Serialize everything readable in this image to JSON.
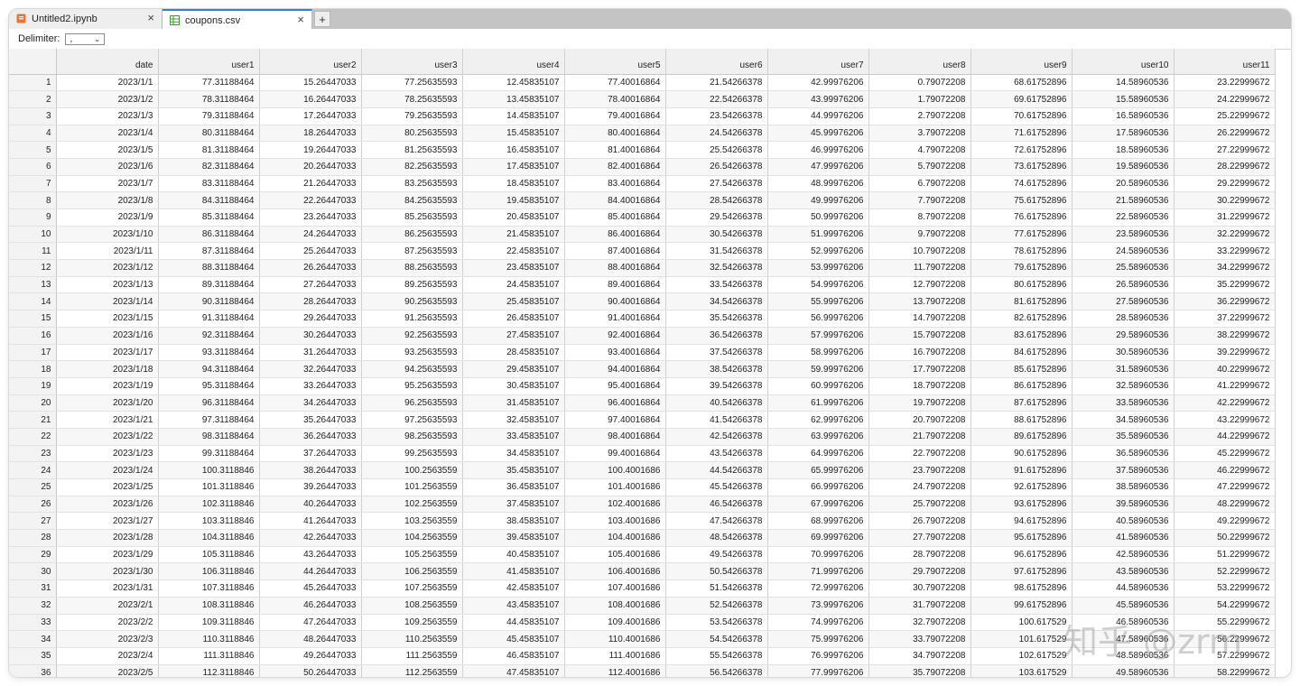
{
  "tabs": [
    {
      "label": "Untitled2.ipynb",
      "icon": "notebook-icon",
      "active": false,
      "icon_color": "#e8743b"
    },
    {
      "label": "coupons.csv",
      "icon": "table-grid-icon",
      "active": true,
      "icon_color": "#3f9c35"
    }
  ],
  "tab_add_label": "+",
  "tab_close_label": "×",
  "toolbar": {
    "delimiter_label": "Delimiter:",
    "delimiter_value": ","
  },
  "columns": [
    "",
    "date",
    "user1",
    "user2",
    "user3",
    "user4",
    "user5",
    "user6",
    "user7",
    "user8",
    "user9",
    "user10",
    "user11"
  ],
  "rows": [
    [
      "1",
      "2023/1/1",
      "77.31188464",
      "15.26447033",
      "77.25635593",
      "12.45835107",
      "77.40016864",
      "21.54266378",
      "42.99976206",
      "0.79072208",
      "68.61752896",
      "14.58960536",
      "23.22999672"
    ],
    [
      "2",
      "2023/1/2",
      "78.31188464",
      "16.26447033",
      "78.25635593",
      "13.45835107",
      "78.40016864",
      "22.54266378",
      "43.99976206",
      "1.79072208",
      "69.61752896",
      "15.58960536",
      "24.22999672"
    ],
    [
      "3",
      "2023/1/3",
      "79.31188464",
      "17.26447033",
      "79.25635593",
      "14.45835107",
      "79.40016864",
      "23.54266378",
      "44.99976206",
      "2.79072208",
      "70.61752896",
      "16.58960536",
      "25.22999672"
    ],
    [
      "4",
      "2023/1/4",
      "80.31188464",
      "18.26447033",
      "80.25635593",
      "15.45835107",
      "80.40016864",
      "24.54266378",
      "45.99976206",
      "3.79072208",
      "71.61752896",
      "17.58960536",
      "26.22999672"
    ],
    [
      "5",
      "2023/1/5",
      "81.31188464",
      "19.26447033",
      "81.25635593",
      "16.45835107",
      "81.40016864",
      "25.54266378",
      "46.99976206",
      "4.79072208",
      "72.61752896",
      "18.58960536",
      "27.22999672"
    ],
    [
      "6",
      "2023/1/6",
      "82.31188464",
      "20.26447033",
      "82.25635593",
      "17.45835107",
      "82.40016864",
      "26.54266378",
      "47.99976206",
      "5.79072208",
      "73.61752896",
      "19.58960536",
      "28.22999672"
    ],
    [
      "7",
      "2023/1/7",
      "83.31188464",
      "21.26447033",
      "83.25635593",
      "18.45835107",
      "83.40016864",
      "27.54266378",
      "48.99976206",
      "6.79072208",
      "74.61752896",
      "20.58960536",
      "29.22999672"
    ],
    [
      "8",
      "2023/1/8",
      "84.31188464",
      "22.26447033",
      "84.25635593",
      "19.45835107",
      "84.40016864",
      "28.54266378",
      "49.99976206",
      "7.79072208",
      "75.61752896",
      "21.58960536",
      "30.22999672"
    ],
    [
      "9",
      "2023/1/9",
      "85.31188464",
      "23.26447033",
      "85.25635593",
      "20.45835107",
      "85.40016864",
      "29.54266378",
      "50.99976206",
      "8.79072208",
      "76.61752896",
      "22.58960536",
      "31.22999672"
    ],
    [
      "10",
      "2023/1/10",
      "86.31188464",
      "24.26447033",
      "86.25635593",
      "21.45835107",
      "86.40016864",
      "30.54266378",
      "51.99976206",
      "9.79072208",
      "77.61752896",
      "23.58960536",
      "32.22999672"
    ],
    [
      "11",
      "2023/1/11",
      "87.31188464",
      "25.26447033",
      "87.25635593",
      "22.45835107",
      "87.40016864",
      "31.54266378",
      "52.99976206",
      "10.79072208",
      "78.61752896",
      "24.58960536",
      "33.22999672"
    ],
    [
      "12",
      "2023/1/12",
      "88.31188464",
      "26.26447033",
      "88.25635593",
      "23.45835107",
      "88.40016864",
      "32.54266378",
      "53.99976206",
      "11.79072208",
      "79.61752896",
      "25.58960536",
      "34.22999672"
    ],
    [
      "13",
      "2023/1/13",
      "89.31188464",
      "27.26447033",
      "89.25635593",
      "24.45835107",
      "89.40016864",
      "33.54266378",
      "54.99976206",
      "12.79072208",
      "80.61752896",
      "26.58960536",
      "35.22999672"
    ],
    [
      "14",
      "2023/1/14",
      "90.31188464",
      "28.26447033",
      "90.25635593",
      "25.45835107",
      "90.40016864",
      "34.54266378",
      "55.99976206",
      "13.79072208",
      "81.61752896",
      "27.58960536",
      "36.22999672"
    ],
    [
      "15",
      "2023/1/15",
      "91.31188464",
      "29.26447033",
      "91.25635593",
      "26.45835107",
      "91.40016864",
      "35.54266378",
      "56.99976206",
      "14.79072208",
      "82.61752896",
      "28.58960536",
      "37.22999672"
    ],
    [
      "16",
      "2023/1/16",
      "92.31188464",
      "30.26447033",
      "92.25635593",
      "27.45835107",
      "92.40016864",
      "36.54266378",
      "57.99976206",
      "15.79072208",
      "83.61752896",
      "29.58960536",
      "38.22999672"
    ],
    [
      "17",
      "2023/1/17",
      "93.31188464",
      "31.26447033",
      "93.25635593",
      "28.45835107",
      "93.40016864",
      "37.54266378",
      "58.99976206",
      "16.79072208",
      "84.61752896",
      "30.58960536",
      "39.22999672"
    ],
    [
      "18",
      "2023/1/18",
      "94.31188464",
      "32.26447033",
      "94.25635593",
      "29.45835107",
      "94.40016864",
      "38.54266378",
      "59.99976206",
      "17.79072208",
      "85.61752896",
      "31.58960536",
      "40.22999672"
    ],
    [
      "19",
      "2023/1/19",
      "95.31188464",
      "33.26447033",
      "95.25635593",
      "30.45835107",
      "95.40016864",
      "39.54266378",
      "60.99976206",
      "18.79072208",
      "86.61752896",
      "32.58960536",
      "41.22999672"
    ],
    [
      "20",
      "2023/1/20",
      "96.31188464",
      "34.26447033",
      "96.25635593",
      "31.45835107",
      "96.40016864",
      "40.54266378",
      "61.99976206",
      "19.79072208",
      "87.61752896",
      "33.58960536",
      "42.22999672"
    ],
    [
      "21",
      "2023/1/21",
      "97.31188464",
      "35.26447033",
      "97.25635593",
      "32.45835107",
      "97.40016864",
      "41.54266378",
      "62.99976206",
      "20.79072208",
      "88.61752896",
      "34.58960536",
      "43.22999672"
    ],
    [
      "22",
      "2023/1/22",
      "98.31188464",
      "36.26447033",
      "98.25635593",
      "33.45835107",
      "98.40016864",
      "42.54266378",
      "63.99976206",
      "21.79072208",
      "89.61752896",
      "35.58960536",
      "44.22999672"
    ],
    [
      "23",
      "2023/1/23",
      "99.31188464",
      "37.26447033",
      "99.25635593",
      "34.45835107",
      "99.40016864",
      "43.54266378",
      "64.99976206",
      "22.79072208",
      "90.61752896",
      "36.58960536",
      "45.22999672"
    ],
    [
      "24",
      "2023/1/24",
      "100.3118846",
      "38.26447033",
      "100.2563559",
      "35.45835107",
      "100.4001686",
      "44.54266378",
      "65.99976206",
      "23.79072208",
      "91.61752896",
      "37.58960536",
      "46.22999672"
    ],
    [
      "25",
      "2023/1/25",
      "101.3118846",
      "39.26447033",
      "101.2563559",
      "36.45835107",
      "101.4001686",
      "45.54266378",
      "66.99976206",
      "24.79072208",
      "92.61752896",
      "38.58960536",
      "47.22999672"
    ],
    [
      "26",
      "2023/1/26",
      "102.3118846",
      "40.26447033",
      "102.2563559",
      "37.45835107",
      "102.4001686",
      "46.54266378",
      "67.99976206",
      "25.79072208",
      "93.61752896",
      "39.58960536",
      "48.22999672"
    ],
    [
      "27",
      "2023/1/27",
      "103.3118846",
      "41.26447033",
      "103.2563559",
      "38.45835107",
      "103.4001686",
      "47.54266378",
      "68.99976206",
      "26.79072208",
      "94.61752896",
      "40.58960536",
      "49.22999672"
    ],
    [
      "28",
      "2023/1/28",
      "104.3118846",
      "42.26447033",
      "104.2563559",
      "39.45835107",
      "104.4001686",
      "48.54266378",
      "69.99976206",
      "27.79072208",
      "95.61752896",
      "41.58960536",
      "50.22999672"
    ],
    [
      "29",
      "2023/1/29",
      "105.3118846",
      "43.26447033",
      "105.2563559",
      "40.45835107",
      "105.4001686",
      "49.54266378",
      "70.99976206",
      "28.79072208",
      "96.61752896",
      "42.58960536",
      "51.22999672"
    ],
    [
      "30",
      "2023/1/30",
      "106.3118846",
      "44.26447033",
      "106.2563559",
      "41.45835107",
      "106.4001686",
      "50.54266378",
      "71.99976206",
      "29.79072208",
      "97.61752896",
      "43.58960536",
      "52.22999672"
    ],
    [
      "31",
      "2023/1/31",
      "107.3118846",
      "45.26447033",
      "107.2563559",
      "42.45835107",
      "107.4001686",
      "51.54266378",
      "72.99976206",
      "30.79072208",
      "98.61752896",
      "44.58960536",
      "53.22999672"
    ],
    [
      "32",
      "2023/2/1",
      "108.3118846",
      "46.26447033",
      "108.2563559",
      "43.45835107",
      "108.4001686",
      "52.54266378",
      "73.99976206",
      "31.79072208",
      "99.61752896",
      "45.58960536",
      "54.22999672"
    ],
    [
      "33",
      "2023/2/2",
      "109.3118846",
      "47.26447033",
      "109.2563559",
      "44.45835107",
      "109.4001686",
      "53.54266378",
      "74.99976206",
      "32.79072208",
      "100.617529",
      "46.58960536",
      "55.22999672"
    ],
    [
      "34",
      "2023/2/3",
      "110.3118846",
      "48.26447033",
      "110.2563559",
      "45.45835107",
      "110.4001686",
      "54.54266378",
      "75.99976206",
      "33.79072208",
      "101.617529",
      "47.58960536",
      "56.22999672"
    ],
    [
      "35",
      "2023/2/4",
      "111.3118846",
      "49.26447033",
      "111.2563559",
      "46.45835107",
      "111.4001686",
      "55.54266378",
      "76.99976206",
      "34.79072208",
      "102.617529",
      "48.58960536",
      "57.22999672"
    ],
    [
      "36",
      "2023/2/5",
      "112.3118846",
      "50.26447033",
      "112.2563559",
      "47.45835107",
      "112.4001686",
      "56.54266378",
      "77.99976206",
      "35.79072208",
      "103.617529",
      "49.58960536",
      "58.22999672"
    ]
  ],
  "watermark_text": "知乎 @zrm"
}
